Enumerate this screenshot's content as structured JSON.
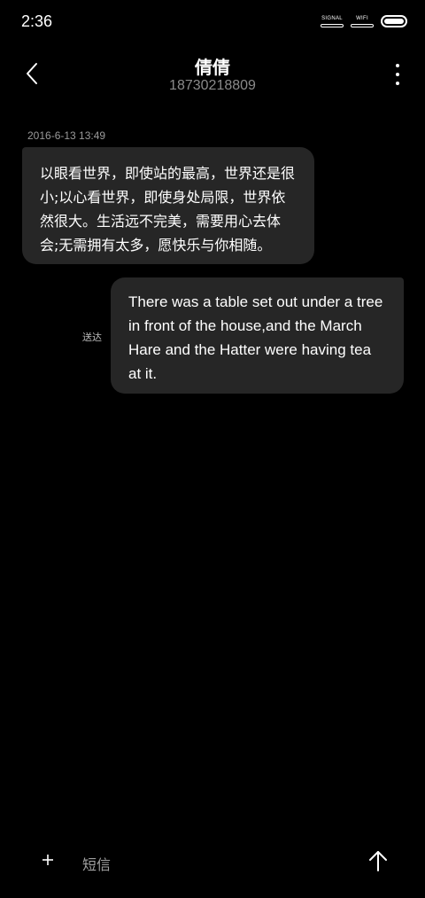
{
  "status_bar": {
    "time": "2:36",
    "signal_label": "SIGNAL",
    "wifi_label": "WIFI",
    "battery_level": 1.0
  },
  "header": {
    "contact_name": "倩倩",
    "contact_number": "18730218809",
    "back_icon": "chevron-left-icon",
    "more_icon": "more-vertical-icon"
  },
  "conversation": {
    "timestamp": "2016-6-13 13:49",
    "messages": [
      {
        "direction": "incoming",
        "lines": [
          "以眼看世界，即使站的最高，世界还是很",
          "小;以心看世界，即使身处局限，世界依",
          "然很大。生活远不完美，需要用心去体",
          "会;无需拥有太多，愿快乐与你相随。"
        ]
      },
      {
        "direction": "outgoing",
        "status": "送达",
        "lines": [
          "There was a table set out under a tree",
          "in front of the house,and the March",
          "Hare and the Hatter were having tea",
          "at it."
        ]
      }
    ]
  },
  "input_bar": {
    "placeholder": "短信",
    "add_icon": "plus-icon",
    "send_icon": "arrow-up-icon"
  },
  "colors": {
    "background": "#000000",
    "bubble": "#262626",
    "secondary_text": "#8a8a8a"
  }
}
